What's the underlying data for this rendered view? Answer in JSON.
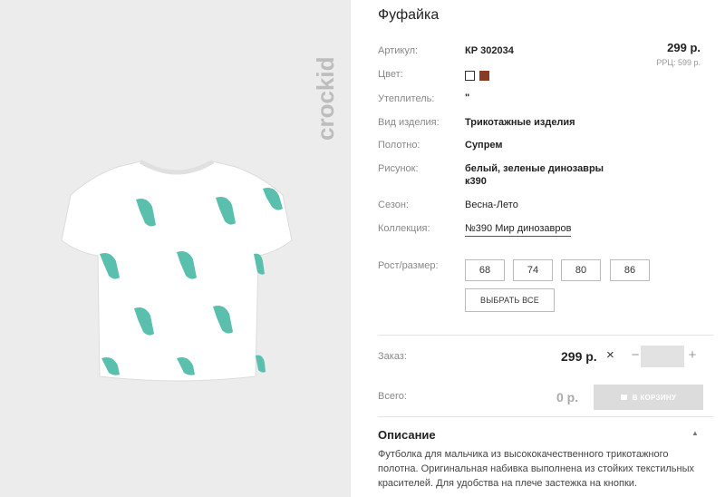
{
  "product": {
    "title": "Фуфайка",
    "brand": "crockid",
    "price": "299 р.",
    "rrp": "РРЦ: 599 р."
  },
  "details": [
    {
      "label": "Артикул:",
      "value": "КР 302034"
    },
    {
      "label": "Цвет:",
      "value": ""
    },
    {
      "label": "Утеплитель:",
      "value": "\""
    },
    {
      "label": "Вид изделия:",
      "value": "Трикотажные изделия"
    },
    {
      "label": "Полотно:",
      "value": "Супрем"
    },
    {
      "label": "Рисунок:",
      "value": "белый, зеленые динозавры",
      "value2": "к390"
    },
    {
      "label": "Сезон:",
      "value": "Весна-Лето"
    },
    {
      "label": "Коллекция:",
      "value": "№390 Мир динозавров"
    }
  ],
  "colors": [
    "#ffffff",
    "#8b3a22"
  ],
  "sizes": {
    "label": "Рост/размер:",
    "options": [
      "68",
      "74",
      "80",
      "86"
    ],
    "select_all": "ВЫБРАТЬ ВСЕ"
  },
  "order": {
    "label": "Заказ:",
    "price": "299 р.",
    "times": "×",
    "minus": "−",
    "plus": "+",
    "quantity": ""
  },
  "total": {
    "label": "Всего:",
    "value": "0 р.",
    "cart_button": "В КОРЗИНУ"
  },
  "description": {
    "title": "Описание",
    "text": "Футболка для мальчика из высококачественного трикотажного полотна. Оригинальная набивка выполнена из стойких текстильных красителей. Для удобства на плече застежка на кнопки."
  }
}
